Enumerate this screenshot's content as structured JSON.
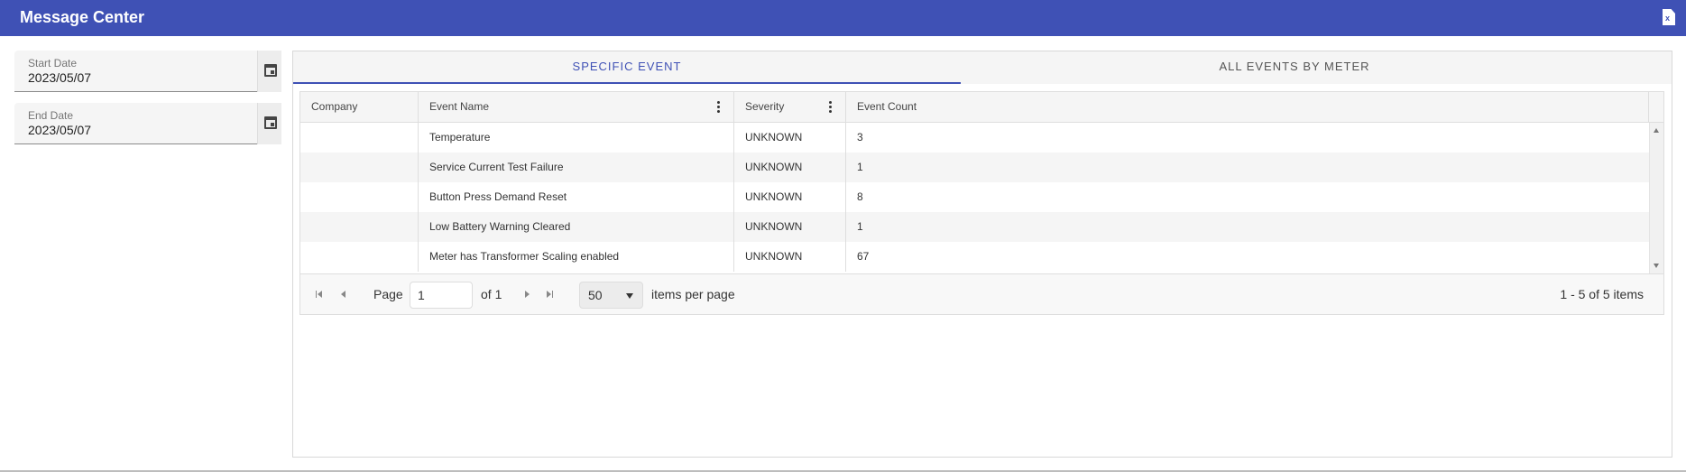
{
  "window": {
    "title": "Message Center",
    "export_icon": "excel-export-icon",
    "accent": "#3f51b5"
  },
  "filters": {
    "start_date": {
      "label": "Start Date",
      "value": "2023/05/07",
      "icon": "calendar-icon"
    },
    "end_date": {
      "label": "End Date",
      "value": "2023/05/07",
      "icon": "calendar-icon"
    }
  },
  "tabs": [
    {
      "label": "SPECIFIC EVENT",
      "active": true
    },
    {
      "label": "ALL EVENTS BY METER",
      "active": false
    }
  ],
  "grid": {
    "columns": [
      "Company",
      "Event Name",
      "Severity",
      "Event Count"
    ],
    "rows": [
      {
        "company": "",
        "event_name": "Temperature",
        "severity": "UNKNOWN",
        "event_count": "3"
      },
      {
        "company": "",
        "event_name": "Service Current Test Failure",
        "severity": "UNKNOWN",
        "event_count": "1"
      },
      {
        "company": "",
        "event_name": "Button Press Demand Reset",
        "severity": "UNKNOWN",
        "event_count": "8"
      },
      {
        "company": "",
        "event_name": "Low Battery Warning Cleared",
        "severity": "UNKNOWN",
        "event_count": "1"
      },
      {
        "company": "",
        "event_name": "Meter has Transformer Scaling enabled",
        "severity": "UNKNOWN",
        "event_count": "67"
      }
    ]
  },
  "pager": {
    "page_label": "Page",
    "page_value": "1",
    "of_label": "of 1",
    "page_size": "50",
    "items_per_page_label": "items per page",
    "summary": "1 - 5 of 5 items"
  }
}
